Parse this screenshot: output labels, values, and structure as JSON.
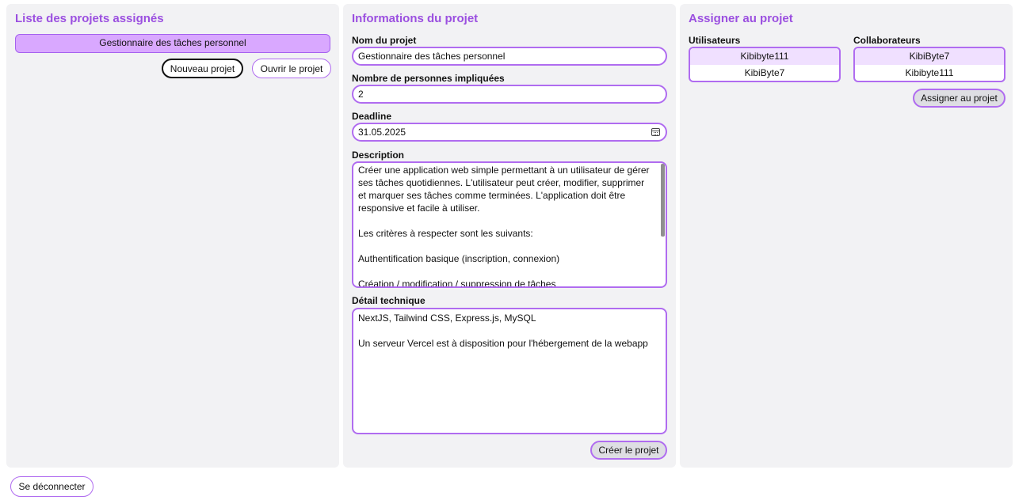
{
  "left_panel": {
    "title": "Liste des projets assignés",
    "projects": [
      "Gestionnaire des tâches personnel"
    ],
    "new_project_label": "Nouveau projet",
    "open_project_label": "Ouvrir le projet"
  },
  "middle_panel": {
    "title": "Informations du projet",
    "name_label": "Nom du projet",
    "name_value": "Gestionnaire des tâches personnel",
    "people_label": "Nombre de personnes impliquées",
    "people_value": "2",
    "deadline_label": "Deadline",
    "deadline_value": "31.05.2025",
    "description_label": "Description",
    "description_paragraphs": [
      "Créer une application web simple permettant à un utilisateur de gérer ses tâches quotidiennes. L'utilisateur peut créer, modifier, supprimer et marquer ses tâches comme terminées. L'application doit être responsive et facile à utiliser.",
      "Les critères à respecter sont les suivants:",
      "Authentification basique (inscription, connexion)",
      "Création / modification / suppression de tâches"
    ],
    "technical_label": "Détail technique",
    "technical_paragraphs": [
      "NextJS, Tailwind CSS, Express.js, MySQL",
      "Un serveur Vercel est à disposition pour l'hébergement de la webapp"
    ],
    "create_label": "Créer le projet"
  },
  "right_panel": {
    "title": "Assigner au projet",
    "users_label": "Utilisateurs",
    "users": [
      "Kibibyte111",
      "KibiByte7"
    ],
    "collaborators_label": "Collaborateurs",
    "collaborators": [
      "KibiByte7",
      "Kibibyte111"
    ],
    "assign_label": "Assigner au projet"
  },
  "footer": {
    "logout_label": "Se déconnecter"
  },
  "colors": {
    "accent": "#9b4fe0",
    "border": "#b06cf0",
    "selected_project": "#d9a8ff",
    "panel_bg": "#f2f2f4"
  }
}
